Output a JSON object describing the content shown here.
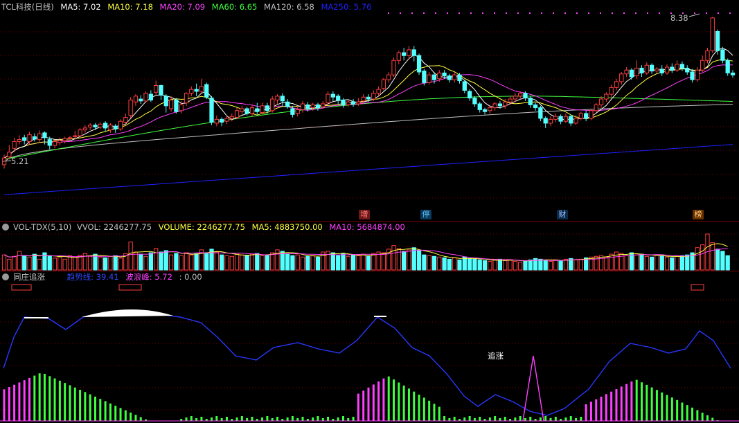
{
  "colors": {
    "up": "#ff4040",
    "down": "#54ffff",
    "ma5": "#ffffff",
    "ma10": "#ffff40",
    "ma20": "#ff40ff",
    "ma60": "#40ff40",
    "ma120": "#c0c0c0",
    "ma250": "#2020ff",
    "grid": "#7a0000",
    "trend": "#2838ff",
    "bar_green": "#40ff40",
    "bar_magenta": "#ff40ff"
  },
  "main": {
    "title": "TCL科技(日线)",
    "ma5": "MA5: 7.02",
    "ma10": "MA10: 7.18",
    "ma20": "MA20: 7.09",
    "ma60": "MA60: 6.65",
    "ma120": "MA120: 6.58",
    "ma250": "MA250: 5.76",
    "high_label": "8.38",
    "low_label": "5.21",
    "tags": [
      "增",
      "停",
      "财",
      "榜"
    ]
  },
  "volume": {
    "title": "VOL-TDX(5,10)",
    "vvol": "VVOL: 2246277.75",
    "volume": "VOLUME: 2246277.75",
    "ma5": "MA5: 4883750.00",
    "ma10": "MA10: 5684874.00"
  },
  "indicator": {
    "title": "同庄追涨",
    "trend": "趋势线: 39.41",
    "wave": "波浪峰: 5.72",
    "extra": ": 0.00",
    "annotation": "追涨"
  },
  "chart_data": {
    "type": "candlestick",
    "ma_values": {
      "MA5": 7.02,
      "MA10": 7.18,
      "MA20": 7.09,
      "MA60": 6.65,
      "MA120": 6.58,
      "MA250": 5.76
    },
    "price_range": [
      4.45,
      8.55
    ],
    "high": 8.38,
    "low": 5.21,
    "candles": [
      [
        5.34,
        5.48,
        5.26,
        5.55
      ],
      [
        5.5,
        5.6,
        5.45,
        5.75
      ],
      [
        5.68,
        5.82,
        5.6,
        5.9
      ],
      [
        5.82,
        5.86,
        5.76,
        5.95
      ],
      [
        5.9,
        5.84,
        5.76,
        5.96
      ],
      [
        5.82,
        5.96,
        5.76,
        6.02
      ],
      [
        5.92,
        5.87,
        5.82,
        5.99
      ],
      [
        5.86,
        5.98,
        5.8,
        6.05
      ],
      [
        6.0,
        5.9,
        5.76,
        6.03
      ],
      [
        5.86,
        5.74,
        5.66,
        5.92
      ],
      [
        5.74,
        5.82,
        5.68,
        5.86
      ],
      [
        5.8,
        5.84,
        5.74,
        5.9
      ],
      [
        5.84,
        5.88,
        5.78,
        5.92
      ],
      [
        5.88,
        5.9,
        5.82,
        5.94
      ],
      [
        5.92,
        5.94,
        5.86,
        6.04
      ],
      [
        5.94,
        6.06,
        5.9,
        6.1
      ],
      [
        6.06,
        6.1,
        6.0,
        6.16
      ],
      [
        6.12,
        6.16,
        6.06,
        6.2
      ],
      [
        6.16,
        6.12,
        6.06,
        6.2
      ],
      [
        6.12,
        6.18,
        6.08,
        6.22
      ],
      [
        6.2,
        6.1,
        6.02,
        6.24
      ],
      [
        6.06,
        6.16,
        6.0,
        6.2
      ],
      [
        6.14,
        6.08,
        6.0,
        6.18
      ],
      [
        6.08,
        6.24,
        6.04,
        6.28
      ],
      [
        6.22,
        6.32,
        6.18,
        6.4
      ],
      [
        6.36,
        6.68,
        6.3,
        6.74
      ],
      [
        6.64,
        6.76,
        6.56,
        6.8
      ],
      [
        6.7,
        6.66,
        6.6,
        6.78
      ],
      [
        6.66,
        6.82,
        6.62,
        6.86
      ],
      [
        6.8,
        6.68,
        6.64,
        6.88
      ],
      [
        6.84,
        6.98,
        6.78,
        7.08
      ],
      [
        6.98,
        6.78,
        6.68,
        7.0
      ],
      [
        6.76,
        6.56,
        6.42,
        6.8
      ],
      [
        6.5,
        6.68,
        6.44,
        6.76
      ],
      [
        6.68,
        6.44,
        6.4,
        6.72
      ],
      [
        6.46,
        6.58,
        6.4,
        6.66
      ],
      [
        6.62,
        6.82,
        6.56,
        6.84
      ],
      [
        6.82,
        6.9,
        6.76,
        6.96
      ],
      [
        6.9,
        6.86,
        6.76,
        7.02
      ],
      [
        6.86,
        6.96,
        6.8,
        7.12
      ],
      [
        7.0,
        6.74,
        6.7,
        7.04
      ],
      [
        6.72,
        6.22,
        6.16,
        6.76
      ],
      [
        6.2,
        6.28,
        6.14,
        6.36
      ],
      [
        6.28,
        6.22,
        6.14,
        6.32
      ],
      [
        6.24,
        6.3,
        6.18,
        6.36
      ],
      [
        6.3,
        6.34,
        6.24,
        6.4
      ],
      [
        6.32,
        6.46,
        6.28,
        6.52
      ],
      [
        6.44,
        6.5,
        6.38,
        6.56
      ],
      [
        6.5,
        6.4,
        6.36,
        6.54
      ],
      [
        6.4,
        6.52,
        6.34,
        6.58
      ],
      [
        6.5,
        6.44,
        6.38,
        6.62
      ],
      [
        6.42,
        6.56,
        6.38,
        6.62
      ],
      [
        6.56,
        6.46,
        6.4,
        6.62
      ],
      [
        6.46,
        6.7,
        6.42,
        6.76
      ],
      [
        6.68,
        6.76,
        6.6,
        6.8
      ],
      [
        6.76,
        6.66,
        6.56,
        6.82
      ],
      [
        6.64,
        6.54,
        6.5,
        6.7
      ],
      [
        6.5,
        6.38,
        6.32,
        6.56
      ],
      [
        6.4,
        6.48,
        6.34,
        6.56
      ],
      [
        6.48,
        6.6,
        6.42,
        6.66
      ],
      [
        6.58,
        6.5,
        6.44,
        6.64
      ],
      [
        6.52,
        6.58,
        6.46,
        6.62
      ],
      [
        6.58,
        6.52,
        6.46,
        6.62
      ],
      [
        6.54,
        6.6,
        6.5,
        6.66
      ],
      [
        6.62,
        6.8,
        6.58,
        6.86
      ],
      [
        6.8,
        6.74,
        6.66,
        6.86
      ],
      [
        6.76,
        6.68,
        6.6,
        6.8
      ],
      [
        6.68,
        6.58,
        6.52,
        6.72
      ],
      [
        6.58,
        6.64,
        6.54,
        6.68
      ],
      [
        6.64,
        6.6,
        6.54,
        6.7
      ],
      [
        6.6,
        6.64,
        6.56,
        6.72
      ],
      [
        6.66,
        6.74,
        6.6,
        6.8
      ],
      [
        6.74,
        6.7,
        6.64,
        6.8
      ],
      [
        6.7,
        6.82,
        6.66,
        6.88
      ],
      [
        6.82,
        6.9,
        6.76,
        6.96
      ],
      [
        6.92,
        7.1,
        6.88,
        7.14
      ],
      [
        7.1,
        7.2,
        7.04,
        7.26
      ],
      [
        7.2,
        7.5,
        7.16,
        7.56
      ],
      [
        7.5,
        7.66,
        7.42,
        7.7
      ],
      [
        7.66,
        7.6,
        7.5,
        7.76
      ],
      [
        7.6,
        7.72,
        7.52,
        7.8
      ],
      [
        7.72,
        7.6,
        7.48,
        7.8
      ],
      [
        7.6,
        7.26,
        7.2,
        7.64
      ],
      [
        7.28,
        7.04,
        6.98,
        7.32
      ],
      [
        7.04,
        7.2,
        7.0,
        7.26
      ],
      [
        7.2,
        7.1,
        7.02,
        7.26
      ],
      [
        7.12,
        7.24,
        7.06,
        7.3
      ],
      [
        7.24,
        7.18,
        7.12,
        7.3
      ],
      [
        7.18,
        7.1,
        7.04,
        7.22
      ],
      [
        7.1,
        7.2,
        7.04,
        7.26
      ],
      [
        7.2,
        7.08,
        7.02,
        7.24
      ],
      [
        7.06,
        6.88,
        6.82,
        7.1
      ],
      [
        6.86,
        6.72,
        6.66,
        6.9
      ],
      [
        6.72,
        6.6,
        6.54,
        6.76
      ],
      [
        6.6,
        6.48,
        6.42,
        6.64
      ],
      [
        6.48,
        6.44,
        6.38,
        6.52
      ],
      [
        6.46,
        6.52,
        6.4,
        6.58
      ],
      [
        6.52,
        6.6,
        6.46,
        6.64
      ],
      [
        6.6,
        6.56,
        6.5,
        6.66
      ],
      [
        6.56,
        6.64,
        6.5,
        6.7
      ],
      [
        6.64,
        6.7,
        6.58,
        6.76
      ],
      [
        6.7,
        6.76,
        6.64,
        6.82
      ],
      [
        6.76,
        6.82,
        6.7,
        6.86
      ],
      [
        6.82,
        6.72,
        6.66,
        6.86
      ],
      [
        6.72,
        6.58,
        6.52,
        6.76
      ],
      [
        6.58,
        6.52,
        6.46,
        6.62
      ],
      [
        6.52,
        6.3,
        6.24,
        6.56
      ],
      [
        6.3,
        6.2,
        6.1,
        6.34
      ],
      [
        6.2,
        6.28,
        6.14,
        6.34
      ],
      [
        6.28,
        6.34,
        6.22,
        6.4
      ],
      [
        6.34,
        6.24,
        6.18,
        6.38
      ],
      [
        6.24,
        6.34,
        6.2,
        6.4
      ],
      [
        6.34,
        6.2,
        6.14,
        6.38
      ],
      [
        6.2,
        6.3,
        6.16,
        6.36
      ],
      [
        6.3,
        6.4,
        6.26,
        6.44
      ],
      [
        6.4,
        6.3,
        6.24,
        6.46
      ],
      [
        6.3,
        6.46,
        6.26,
        6.5
      ],
      [
        6.46,
        6.58,
        6.42,
        6.62
      ],
      [
        6.58,
        6.7,
        6.52,
        6.76
      ],
      [
        6.7,
        6.8,
        6.64,
        6.84
      ],
      [
        6.8,
        6.94,
        6.74,
        7.0
      ],
      [
        6.94,
        7.06,
        6.88,
        7.12
      ],
      [
        7.06,
        7.22,
        7.0,
        7.26
      ],
      [
        7.22,
        7.3,
        7.16,
        7.36
      ],
      [
        7.3,
        7.16,
        7.1,
        7.34
      ],
      [
        7.18,
        7.34,
        7.12,
        7.5
      ],
      [
        7.34,
        7.24,
        7.16,
        7.4
      ],
      [
        7.24,
        7.4,
        7.2,
        7.46
      ],
      [
        7.4,
        7.28,
        7.22,
        7.44
      ],
      [
        7.28,
        7.32,
        7.24,
        7.36
      ],
      [
        7.32,
        7.24,
        7.18,
        7.4
      ],
      [
        7.24,
        7.36,
        7.2,
        7.42
      ],
      [
        7.36,
        7.3,
        7.24,
        7.44
      ],
      [
        7.3,
        7.42,
        7.26,
        7.5
      ],
      [
        7.42,
        7.34,
        7.28,
        7.48
      ],
      [
        7.34,
        7.26,
        7.2,
        7.4
      ],
      [
        7.26,
        7.1,
        7.04,
        7.32
      ],
      [
        7.1,
        7.3,
        7.06,
        7.36
      ],
      [
        7.3,
        7.5,
        7.26,
        7.6
      ],
      [
        7.5,
        7.7,
        7.44,
        7.76
      ],
      [
        7.7,
        8.38,
        7.66,
        8.4
      ],
      [
        8.1,
        7.7,
        7.62,
        8.14
      ],
      [
        7.72,
        7.5,
        7.44,
        7.78
      ],
      [
        7.5,
        7.24,
        7.18,
        7.54
      ],
      [
        7.24,
        7.2,
        7.14,
        7.3
      ]
    ],
    "volume_bars": [
      0.42,
      0.3,
      0.38,
      0.52,
      0.4,
      0.36,
      0.44,
      0.3,
      0.48,
      0.4,
      0.33,
      0.36,
      0.3,
      0.4,
      0.35,
      0.41,
      0.46,
      0.38,
      0.44,
      0.36,
      0.34,
      0.38,
      0.4,
      0.33,
      0.46,
      0.78,
      0.5,
      0.44,
      0.38,
      0.48,
      0.6,
      0.5,
      0.54,
      0.42,
      0.46,
      0.4,
      0.48,
      0.42,
      0.45,
      0.56,
      0.48,
      0.58,
      0.5,
      0.42,
      0.4,
      0.38,
      0.46,
      0.42,
      0.4,
      0.44,
      0.46,
      0.4,
      0.42,
      0.48,
      0.56,
      0.52,
      0.44,
      0.4,
      0.42,
      0.36,
      0.38,
      0.4,
      0.36,
      0.5,
      0.52,
      0.48,
      0.4,
      0.46,
      0.38,
      0.42,
      0.4,
      0.44,
      0.38,
      0.46,
      0.5,
      0.48,
      0.58,
      0.68,
      0.6,
      0.52,
      0.56,
      0.62,
      0.54,
      0.42,
      0.4,
      0.38,
      0.36,
      0.34,
      0.3,
      0.34,
      0.28,
      0.36,
      0.32,
      0.3,
      0.28,
      0.26,
      0.24,
      0.28,
      0.3,
      0.26,
      0.28,
      0.24,
      0.22,
      0.26,
      0.28,
      0.32,
      0.3,
      0.26,
      0.24,
      0.28,
      0.26,
      0.3,
      0.32,
      0.28,
      0.3,
      0.34,
      0.36,
      0.38,
      0.4,
      0.36,
      0.44,
      0.5,
      0.46,
      0.4,
      0.48,
      0.42,
      0.44,
      0.38,
      0.36,
      0.42,
      0.4,
      0.36,
      0.34,
      0.38,
      0.4,
      0.42,
      0.48,
      0.62,
      0.7,
      1.0,
      0.76,
      0.58,
      0.52,
      0.4
    ]
  }
}
